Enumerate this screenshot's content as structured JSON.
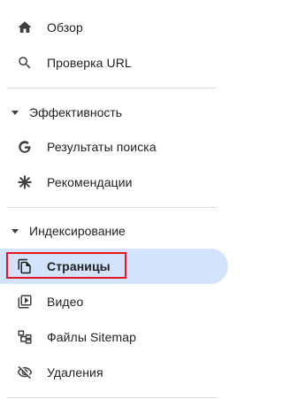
{
  "nav": {
    "overview": {
      "label": "Обзор",
      "icon": "home-icon"
    },
    "url_inspection": {
      "label": "Проверка URL",
      "icon": "search-icon"
    },
    "performance_section": {
      "label": "Эффективность"
    },
    "search_results": {
      "label": "Результаты поиска",
      "icon": "google-g-icon"
    },
    "recommendations": {
      "label": "Рекомендации",
      "icon": "asterisk-icon"
    },
    "indexing_section": {
      "label": "Индексирование"
    },
    "pages": {
      "label": "Страницы",
      "icon": "pages-icon",
      "active": true
    },
    "video": {
      "label": "Видео",
      "icon": "video-pages-icon"
    },
    "sitemaps": {
      "label": "Файлы Sitemap",
      "icon": "sitemap-icon"
    },
    "removals": {
      "label": "Удаления",
      "icon": "eye-off-icon"
    }
  },
  "colors": {
    "active_bg": "#d3e3fd",
    "highlight_border": "#e5141f",
    "divider": "#dadce0",
    "icon": "#3c4043"
  }
}
